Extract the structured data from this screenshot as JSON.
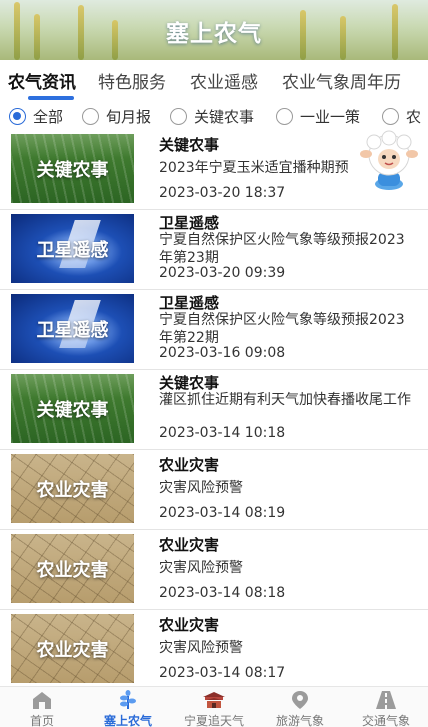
{
  "banner": {
    "title": "塞上农气"
  },
  "tabs": [
    {
      "label": "农气资讯",
      "active": true
    },
    {
      "label": "特色服务"
    },
    {
      "label": "农业遥感"
    },
    {
      "label": "农业气象周年历"
    }
  ],
  "filters": [
    {
      "label": "全部",
      "selected": true
    },
    {
      "label": "旬月报"
    },
    {
      "label": "关键农事"
    },
    {
      "label": "一业一策"
    },
    {
      "label": "农"
    }
  ],
  "news": [
    {
      "thumb_label": "关键农事",
      "category": "关键农事",
      "title": "2023年宁夏玉米适宜播种期预",
      "time": "2023-03-20 18:37"
    },
    {
      "thumb_label": "卫星遥感",
      "category": "卫星遥感",
      "title": "宁夏自然保护区火险气象等级预报2023年第23期",
      "time": "2023-03-20 09:39"
    },
    {
      "thumb_label": "卫星遥感",
      "category": "卫星遥感",
      "title": "宁夏自然保护区火险气象等级预报2023年第22期",
      "time": "2023-03-16 09:08"
    },
    {
      "thumb_label": "关键农事",
      "category": "关键农事",
      "title": "灌区抓住近期有利天气加快春播收尾工作",
      "time": "2023-03-14 10:18"
    },
    {
      "thumb_label": "农业灾害",
      "category": "农业灾害",
      "title": "灾害风险预警",
      "time": "2023-03-14 08:19"
    },
    {
      "thumb_label": "农业灾害",
      "category": "农业灾害",
      "title": "灾害风险预警",
      "time": "2023-03-14 08:18"
    },
    {
      "thumb_label": "农业灾害",
      "category": "农业灾害",
      "title": "灾害风险预警",
      "time": "2023-03-14 08:17"
    }
  ],
  "bottom_nav": [
    {
      "label": "首页",
      "icon": "home-icon"
    },
    {
      "label": "塞上农气",
      "icon": "agri-weather-icon",
      "active": true
    },
    {
      "label": "宁夏追天气",
      "icon": "pavilion-icon"
    },
    {
      "label": "旅游气象",
      "icon": "travel-pin-icon"
    },
    {
      "label": "交通气象",
      "icon": "road-icon"
    }
  ],
  "colors": {
    "accent": "#2a6bd8",
    "tab_underline": "#2d6fde"
  }
}
